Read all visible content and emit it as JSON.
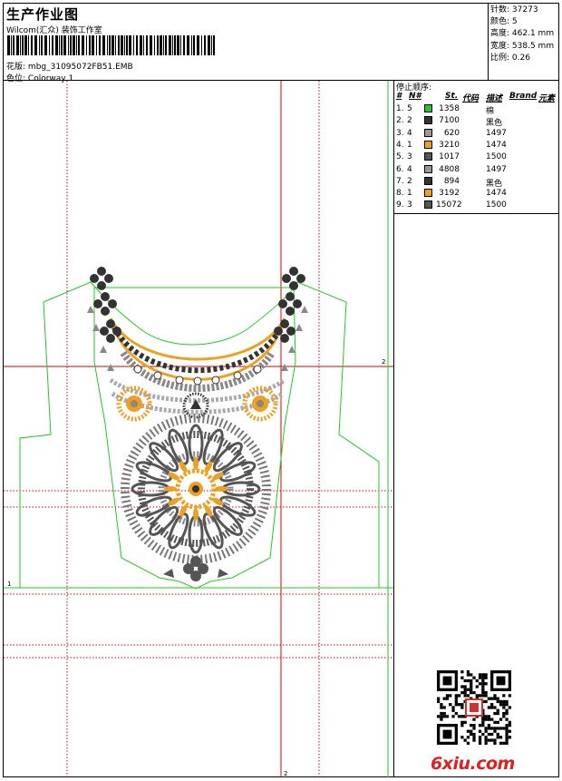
{
  "header": {
    "title": "生产作业图",
    "company": "Wilcom(汇众) 装饰工作室",
    "file_label": "花版:",
    "file_name": "mbg_31095072FB51.EMB",
    "colorway_label": "色位:",
    "colorway": "Colorway 1"
  },
  "specs": [
    {
      "label": "针数:",
      "value": "37273"
    },
    {
      "label": "颜色:",
      "value": "5"
    },
    {
      "label": "高度:",
      "value": "462.1 mm"
    },
    {
      "label": "宽度:",
      "value": "538.5 mm"
    },
    {
      "label": "比例:",
      "value": "0.26"
    }
  ],
  "stop_sequence": {
    "title": "停止顺序:",
    "columns": [
      "#",
      "N#",
      "St.",
      "代码",
      "描述",
      "Brand",
      "元素"
    ],
    "rows": [
      {
        "seq": "1.",
        "needle": "5",
        "color": "#22cc22",
        "stitches": "1358",
        "code": "棉",
        "desc": ""
      },
      {
        "seq": "2.",
        "needle": "2",
        "color": "#333333",
        "stitches": "7100",
        "code": "",
        "desc": "黑色"
      },
      {
        "seq": "3.",
        "needle": "4",
        "color": "#999999",
        "stitches": "620",
        "code": "",
        "desc": "1497"
      },
      {
        "seq": "4.",
        "needle": "1",
        "color": "#f0a020",
        "stitches": "3210",
        "code": "",
        "desc": "1474"
      },
      {
        "seq": "5.",
        "needle": "3",
        "color": "#555555",
        "stitches": "1017",
        "code": "",
        "desc": "1500"
      },
      {
        "seq": "6.",
        "needle": "4",
        "color": "#999999",
        "stitches": "4808",
        "code": "",
        "desc": "1497"
      },
      {
        "seq": "7.",
        "needle": "2",
        "color": "#333333",
        "stitches": "894",
        "code": "",
        "desc": "黑色"
      },
      {
        "seq": "8.",
        "needle": "1",
        "color": "#f0a020",
        "stitches": "3192",
        "code": "",
        "desc": "1474"
      },
      {
        "seq": "9.",
        "needle": "3",
        "color": "#555555",
        "stitches": "15072",
        "code": "",
        "desc": "1500"
      }
    ]
  },
  "guides": {
    "h_label_right": "2",
    "h_label_left": "1",
    "v_label_bottom": "2"
  },
  "watermark": "6xiu.com",
  "colors": {
    "outline": "#22cc22",
    "guide_red": "#e00000",
    "thread_gold": "#f0a020",
    "thread_grey": "#888888",
    "thread_dark": "#333333"
  },
  "icons": [
    "barcode-icon",
    "qr-code-icon",
    "embroidery-design-icon"
  ]
}
